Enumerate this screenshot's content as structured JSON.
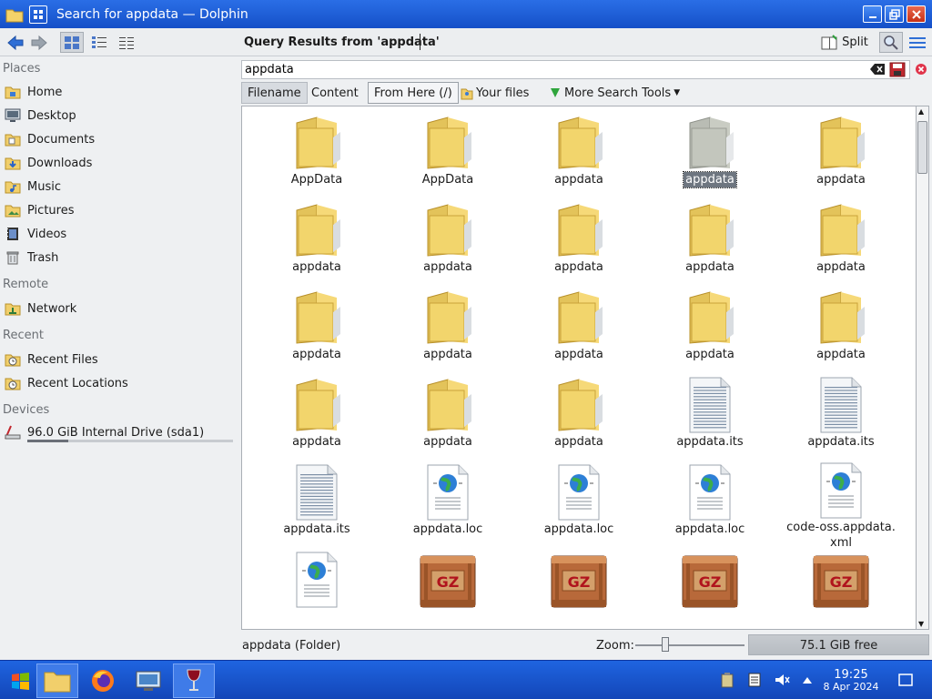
{
  "window": {
    "title": "Search for appdata — Dolphin"
  },
  "toolbar": {
    "location_label": "Query Results from 'appdata'",
    "split_label": "Split"
  },
  "sidebar": {
    "sections": {
      "places": "Places",
      "remote": "Remote",
      "recent": "Recent",
      "devices": "Devices"
    },
    "places": [
      {
        "label": "Home",
        "icon": "home-folder-icon"
      },
      {
        "label": "Desktop",
        "icon": "desktop-icon"
      },
      {
        "label": "Documents",
        "icon": "documents-folder-icon"
      },
      {
        "label": "Downloads",
        "icon": "downloads-folder-icon"
      },
      {
        "label": "Music",
        "icon": "music-folder-icon"
      },
      {
        "label": "Pictures",
        "icon": "pictures-folder-icon"
      },
      {
        "label": "Videos",
        "icon": "videos-folder-icon"
      },
      {
        "label": "Trash",
        "icon": "trash-icon"
      }
    ],
    "remote": [
      {
        "label": "Network",
        "icon": "network-folder-icon"
      }
    ],
    "recent": [
      {
        "label": "Recent Files",
        "icon": "recent-files-icon"
      },
      {
        "label": "Recent Locations",
        "icon": "recent-locations-icon"
      }
    ],
    "devices": [
      {
        "label": "96.0 GiB Internal Drive (sda1)",
        "icon": "drive-icon",
        "usage_fraction": 0.2
      }
    ]
  },
  "search": {
    "query": "appdata",
    "filters": {
      "filename": "Filename",
      "content": "Content",
      "from_here": "From Here (/)",
      "your_files": "Your files",
      "more_tools": "More Search Tools"
    }
  },
  "files": [
    {
      "name": "AppData",
      "type": "folder"
    },
    {
      "name": "AppData",
      "type": "folder"
    },
    {
      "name": "appdata",
      "type": "folder"
    },
    {
      "name": "appdata",
      "type": "folder-selected"
    },
    {
      "name": "appdata",
      "type": "folder"
    },
    {
      "name": "appdata",
      "type": "folder"
    },
    {
      "name": "appdata",
      "type": "folder"
    },
    {
      "name": "appdata",
      "type": "folder"
    },
    {
      "name": "appdata",
      "type": "folder"
    },
    {
      "name": "appdata",
      "type": "folder"
    },
    {
      "name": "appdata",
      "type": "folder"
    },
    {
      "name": "appdata",
      "type": "folder"
    },
    {
      "name": "appdata",
      "type": "folder"
    },
    {
      "name": "appdata",
      "type": "folder"
    },
    {
      "name": "appdata",
      "type": "folder"
    },
    {
      "name": "appdata",
      "type": "folder"
    },
    {
      "name": "appdata",
      "type": "folder"
    },
    {
      "name": "appdata",
      "type": "folder"
    },
    {
      "name": "appdata.its",
      "type": "text"
    },
    {
      "name": "appdata.its",
      "type": "text"
    },
    {
      "name": "appdata.its",
      "type": "text"
    },
    {
      "name": "appdata.loc",
      "type": "web"
    },
    {
      "name": "appdata.loc",
      "type": "web"
    },
    {
      "name": "appdata.loc",
      "type": "web"
    },
    {
      "name": "code-oss.appdata.\nxml",
      "type": "web"
    },
    {
      "name": "",
      "type": "web"
    },
    {
      "name": "",
      "type": "gz"
    },
    {
      "name": "",
      "type": "gz"
    },
    {
      "name": "",
      "type": "gz"
    },
    {
      "name": "",
      "type": "gz"
    }
  ],
  "status": {
    "text": "appdata (Folder)",
    "zoom_label": "Zoom:",
    "free_space": "75.1 GiB free"
  },
  "taskbar": {
    "time": "19:25",
    "date": "8 Apr 2024"
  }
}
